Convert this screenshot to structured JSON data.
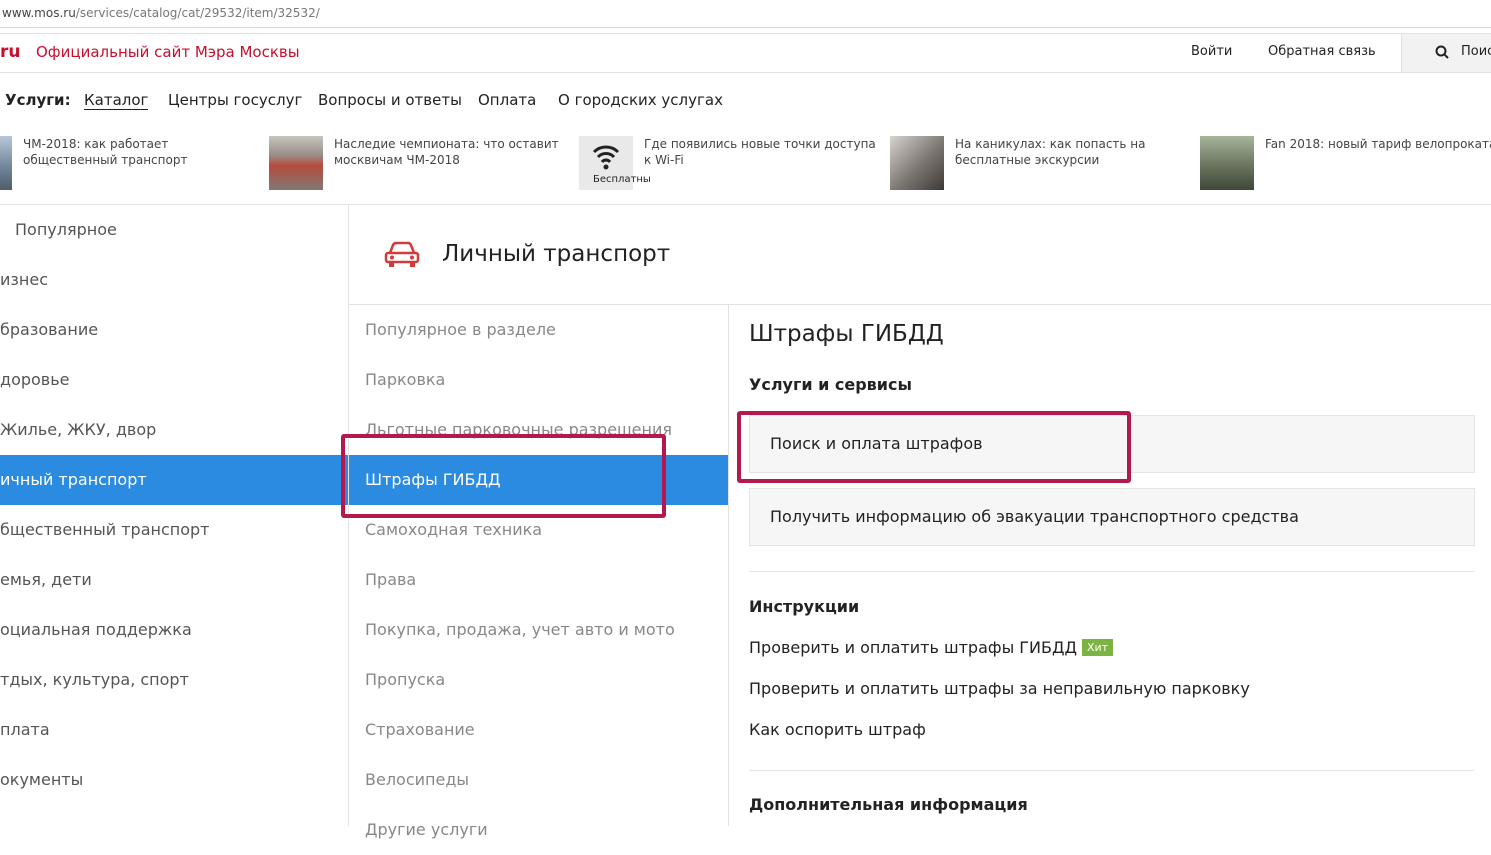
{
  "url": {
    "domain": "www.mos.ru",
    "path": "/services/catalog/cat/29532/item/32532/"
  },
  "header": {
    "logo": "ru",
    "site_title": "Официальный сайт Мэра Москвы",
    "login": "Войти",
    "feedback": "Обратная связь",
    "search_label": "Поис"
  },
  "servnav": {
    "label": "Услуги:",
    "items": [
      "Каталог",
      "Центры госуслуг",
      "Вопросы и ответы",
      "Оплата",
      "О городских услугах"
    ]
  },
  "news": [
    {
      "text": "ЧМ-2018: как работает общественный транспорт"
    },
    {
      "text": "Наследие чемпионата: что оставит москвичам ЧМ-2018"
    },
    {
      "text": "Где появились новые точки доступа к Wi-Fi",
      "thumb_caption": "Бесплатны"
    },
    {
      "text": "На каникулах: как попасть на бесплатные экскурсии"
    },
    {
      "text": "Fan 2018: новый тариф велопроката"
    }
  ],
  "categories": [
    "Популярное",
    "изнес",
    "бразование",
    "доровье",
    "Жилье, ЖКУ, двор",
    "ичный транспорт",
    "бщественный транспорт",
    "емья, дети",
    "оциальная поддержка",
    "тдых, культура, спорт",
    "плата",
    "окументы"
  ],
  "active_category_index": 5,
  "section": {
    "title": "Личный транспорт"
  },
  "subcategories": [
    "Популярное в разделе",
    "Парковка",
    "Льготные парковочные разрешения",
    "Штрафы ГИБДД",
    "Самоходная техника",
    "Права",
    "Покупка, продажа, учет авто и мото",
    "Пропуска",
    "Страхование",
    "Велосипеды",
    "Другие услуги"
  ],
  "active_subcategory_index": 3,
  "detail": {
    "title": "Штрафы ГИБДД",
    "services_heading": "Услуги и сервисы",
    "services": [
      "Поиск и оплата штрафов",
      "Получить информацию об эвакуации транспортного средства"
    ],
    "instructions_heading": "Инструкции",
    "instructions": [
      {
        "text": "Проверить и оплатить штрафы ГИБДД",
        "badge": "Хит"
      },
      {
        "text": "Проверить и оплатить штрафы за неправильную парковку"
      },
      {
        "text": "Как оспорить штраф"
      }
    ],
    "more_heading": "Дополнительная информация"
  },
  "colors": {
    "brand": "#c8102e",
    "active": "#2a8be0",
    "annotation": "#b5174f",
    "badge": "#7cb342"
  }
}
